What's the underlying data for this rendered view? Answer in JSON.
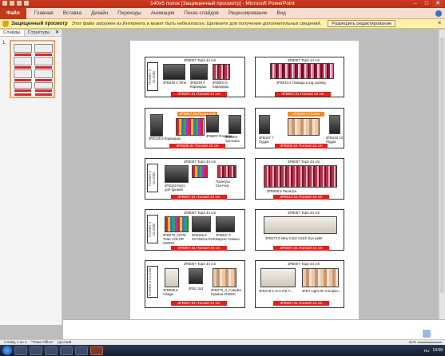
{
  "window": {
    "title": "140x5 полок [Защищенный просмотр] - Microsoft PowerPoint"
  },
  "ribbon": {
    "tabs": [
      "Файл",
      "Главная",
      "Вставка",
      "Дизайн",
      "Переходы",
      "Анимация",
      "Показ слайдов",
      "Рецензирование",
      "Вид"
    ]
  },
  "protected_view": {
    "title": "Защищенный просмотр",
    "message": "Этот файл загружен из Интернета и может быть небезопасен. Щелкните для получения дополнительных сведений.",
    "enable_button": "Разрешить редактирование"
  },
  "left_panel": {
    "tabs": [
      "Слайды",
      "Структура"
    ],
    "slide_number": "1"
  },
  "slide": {
    "row1": {
      "left_code": "3FB007 Top3 44 cm",
      "left_items": [
        "3FB248 3 Time",
        "3FB249 4 Карандаш",
        "3FB004 5 Карандаш"
      ],
      "left_bar": "3FB007.01 Полкой 44 cm",
      "side_label": "ПОЛКА 3 CLOSE",
      "right_code": "3FB007 Top3 44 cm",
      "right_item": "3FB010.6 Помада Long-Lasting",
      "right_bar": "3FB007.01 Полкой 44 cm"
    },
    "row2": {
      "left_orange": "3FB007.05 Полка для Акции",
      "left_items": [
        "3FB135.6 Карандаш",
        "3FB007 Помада",
        "3FB004 Sumcase"
      ],
      "left_bar": "3FB008.01 Полкой 33 cm",
      "right_orange": "3FB300.5 Полка для...",
      "right_items": [
        "3FB107 7 Пудра",
        "3FB133 13 Пудра"
      ],
      "right_bar": "3FB009.01 Полкой 33 cm"
    },
    "row3": {
      "left_code": "3FB007 Top3 44 cm",
      "left_items": [
        "3FB153 Мусс для бровей",
        "Палитры Скетчер"
      ],
      "left_bar": "3FB007.01 Полкой 44 cm",
      "side_label": "ПОЛКА 3 CLOSE",
      "right_code": "3FB007 Top3 44 cm",
      "right_item": "3FB008.6 Палитра",
      "right_bar": "3FB010.01 Полкой 44 cm"
    },
    "row4": {
      "left_code": "3FB007 Top3 44 cm",
      "left_items": [
        "3FB270_HYPE Тени COLOR SWING",
        "3FB156.8 SCANDALOUS",
        "3FB027.3 Бархат Сиянье"
      ],
      "left_bar": "3FB007.01 Полкой 44 cm",
      "side_label": "ПОЛКА 3 CLOSE",
      "right_code": "3FB007 Top3 44 cm",
      "right_item": "3FB173.9 New Color Catch Eye palet",
      "right_bar": "3FB007.01 Полкой 44 cm"
    },
    "row5": {
      "left_code": "3FB007 Top3 44 cm",
      "left_items": [
        "3FB005.6 Visage",
        "3FB1 3x3",
        "3FB270_0_complex Румяна CHEEK"
      ],
      "left_bar": "3FB007.01 Полкой 44 cm",
      "side_label": "ПОЛКА 3 CLOSE",
      "right_code": "3FB007 Top3 44 cm",
      "right_items": [
        "3FB178 С.О.С.Р.Е.Т...",
        "3FB7 Light Re Complex..."
      ],
      "right_bar": "3FB007.01 Полкой 44 cm"
    },
    "logo": "BelorDesign"
  },
  "status": {
    "slide": "Слайд 1 из 1",
    "theme": "\"Тема Office\"",
    "language": "русский",
    "zoom": "41%"
  },
  "taskbar": {
    "language": "RU",
    "time": "14:58"
  }
}
